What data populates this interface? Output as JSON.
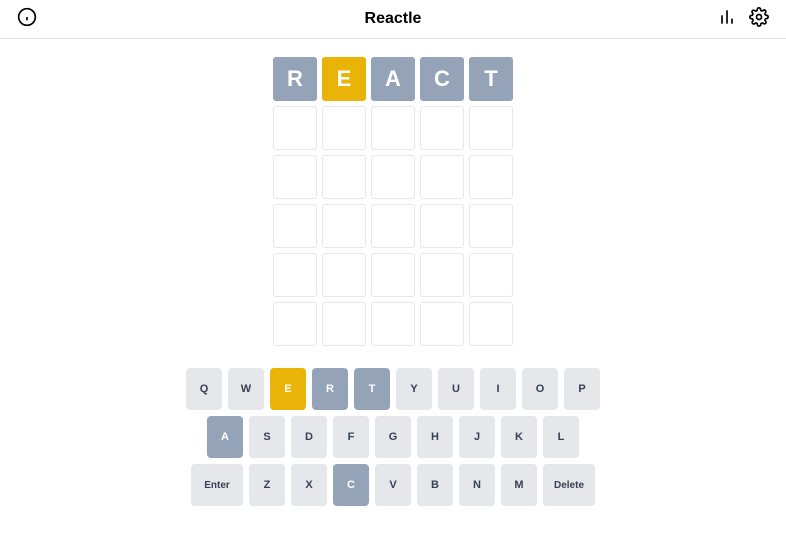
{
  "header": {
    "title": "Reactle"
  },
  "board": {
    "rows": 6,
    "cols": 5,
    "guesses": [
      [
        {
          "letter": "R",
          "state": "absent"
        },
        {
          "letter": "E",
          "state": "present"
        },
        {
          "letter": "A",
          "state": "absent"
        },
        {
          "letter": "C",
          "state": "absent"
        },
        {
          "letter": "T",
          "state": "absent"
        }
      ],
      [
        {
          "letter": "",
          "state": "empty"
        },
        {
          "letter": "",
          "state": "empty"
        },
        {
          "letter": "",
          "state": "empty"
        },
        {
          "letter": "",
          "state": "empty"
        },
        {
          "letter": "",
          "state": "empty"
        }
      ],
      [
        {
          "letter": "",
          "state": "empty"
        },
        {
          "letter": "",
          "state": "empty"
        },
        {
          "letter": "",
          "state": "empty"
        },
        {
          "letter": "",
          "state": "empty"
        },
        {
          "letter": "",
          "state": "empty"
        }
      ],
      [
        {
          "letter": "",
          "state": "empty"
        },
        {
          "letter": "",
          "state": "empty"
        },
        {
          "letter": "",
          "state": "empty"
        },
        {
          "letter": "",
          "state": "empty"
        },
        {
          "letter": "",
          "state": "empty"
        }
      ],
      [
        {
          "letter": "",
          "state": "empty"
        },
        {
          "letter": "",
          "state": "empty"
        },
        {
          "letter": "",
          "state": "empty"
        },
        {
          "letter": "",
          "state": "empty"
        },
        {
          "letter": "",
          "state": "empty"
        }
      ],
      [
        {
          "letter": "",
          "state": "empty"
        },
        {
          "letter": "",
          "state": "empty"
        },
        {
          "letter": "",
          "state": "empty"
        },
        {
          "letter": "",
          "state": "empty"
        },
        {
          "letter": "",
          "state": "empty"
        }
      ]
    ]
  },
  "keyboard": {
    "rows": [
      [
        {
          "label": "Q",
          "state": "default"
        },
        {
          "label": "W",
          "state": "default"
        },
        {
          "label": "E",
          "state": "present"
        },
        {
          "label": "R",
          "state": "absent"
        },
        {
          "label": "T",
          "state": "absent"
        },
        {
          "label": "Y",
          "state": "default"
        },
        {
          "label": "U",
          "state": "default"
        },
        {
          "label": "I",
          "state": "default"
        },
        {
          "label": "O",
          "state": "default"
        },
        {
          "label": "P",
          "state": "default"
        }
      ],
      [
        {
          "label": "A",
          "state": "absent"
        },
        {
          "label": "S",
          "state": "default"
        },
        {
          "label": "D",
          "state": "default"
        },
        {
          "label": "F",
          "state": "default"
        },
        {
          "label": "G",
          "state": "default"
        },
        {
          "label": "H",
          "state": "default"
        },
        {
          "label": "J",
          "state": "default"
        },
        {
          "label": "K",
          "state": "default"
        },
        {
          "label": "L",
          "state": "default"
        }
      ],
      [
        {
          "label": "Enter",
          "state": "default",
          "wide": true
        },
        {
          "label": "Z",
          "state": "default"
        },
        {
          "label": "X",
          "state": "default"
        },
        {
          "label": "C",
          "state": "absent"
        },
        {
          "label": "V",
          "state": "default"
        },
        {
          "label": "B",
          "state": "default"
        },
        {
          "label": "N",
          "state": "default"
        },
        {
          "label": "M",
          "state": "default"
        },
        {
          "label": "Delete",
          "state": "default",
          "wide": true
        }
      ]
    ]
  }
}
